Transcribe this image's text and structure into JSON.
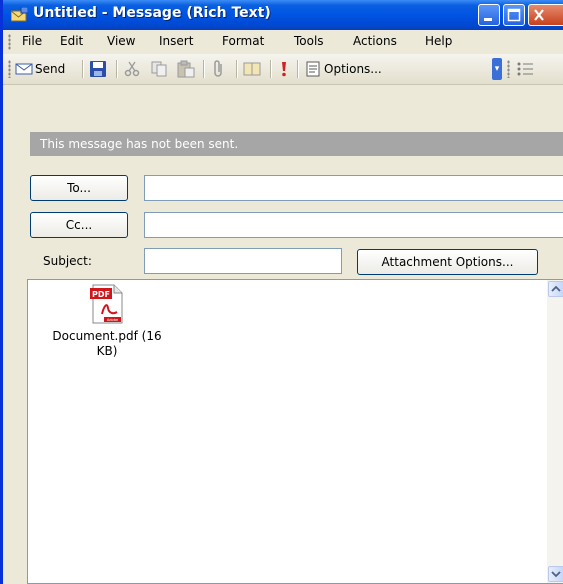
{
  "window": {
    "title": "Untitled - Message (Rich Text)"
  },
  "menu": [
    "File",
    "Edit",
    "View",
    "Insert",
    "Format",
    "Tools",
    "Actions",
    "Help"
  ],
  "toolbar": {
    "send_label": "Send",
    "options_label": "Options..."
  },
  "info": {
    "message": "This message has not been sent."
  },
  "header": {
    "to_label": "To...",
    "cc_label": "Cc...",
    "subject_label": "Subject:",
    "attachment_options_label": "Attachment Options...",
    "to_value": "",
    "cc_value": "",
    "subject_value": ""
  },
  "attachment": {
    "name": "Document.pdf (16 KB)",
    "badge": "PDF",
    "brand": "Adobe"
  },
  "icons": [
    "window-icon",
    "minimize-icon",
    "maximize-icon",
    "close-icon",
    "send-icon",
    "save-icon",
    "cut-icon",
    "copy-icon",
    "paste-icon",
    "paperclip-icon",
    "address-book-icon",
    "importance-icon",
    "options-icon",
    "bullets-icon",
    "pdf-icon",
    "scroll-up-icon",
    "scroll-down-icon"
  ],
  "colors": {
    "title_blue": "#0054e3",
    "info_gray": "#a6a6a6",
    "pdf_red": "#d0161b"
  }
}
